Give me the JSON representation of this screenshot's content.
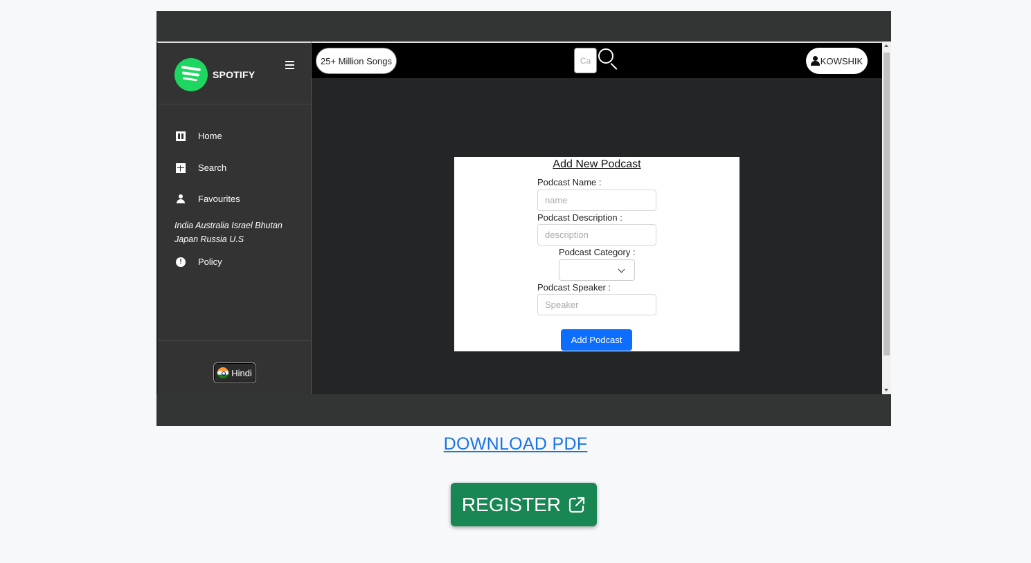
{
  "sidebar": {
    "brand": "SPOTIFY",
    "items": [
      {
        "label": "Home",
        "icon": "home-icon"
      },
      {
        "label": "Search",
        "icon": "grid-icon"
      },
      {
        "label": "Favourites",
        "icon": "user-icon"
      },
      {
        "label": "Policy",
        "icon": "info-icon"
      }
    ],
    "countries": "India Australia Israel Bhutan Japan Russia U.S",
    "language": "Hindi"
  },
  "topbar": {
    "songs_badge": "25+ Million Songs",
    "search_placeholder": "Ca",
    "user_name": "KOWSHIK"
  },
  "form": {
    "title": "Add New Podcast",
    "name_label": "Podcast Name :",
    "name_placeholder": "name",
    "description_label": "Podcast Description :",
    "description_placeholder": "description",
    "category_label": "Podcast Category :",
    "speaker_label": "Podcast Speaker :",
    "speaker_placeholder": "Speaker",
    "submit_label": "Add Podcast"
  },
  "page": {
    "download_label": "DOWNLOAD PDF",
    "register_label": "REGISTER"
  },
  "colors": {
    "spotify_green": "#1ed760",
    "primary_blue": "#0d6efd",
    "register_green": "#198754",
    "link_blue": "#1a73e8"
  }
}
